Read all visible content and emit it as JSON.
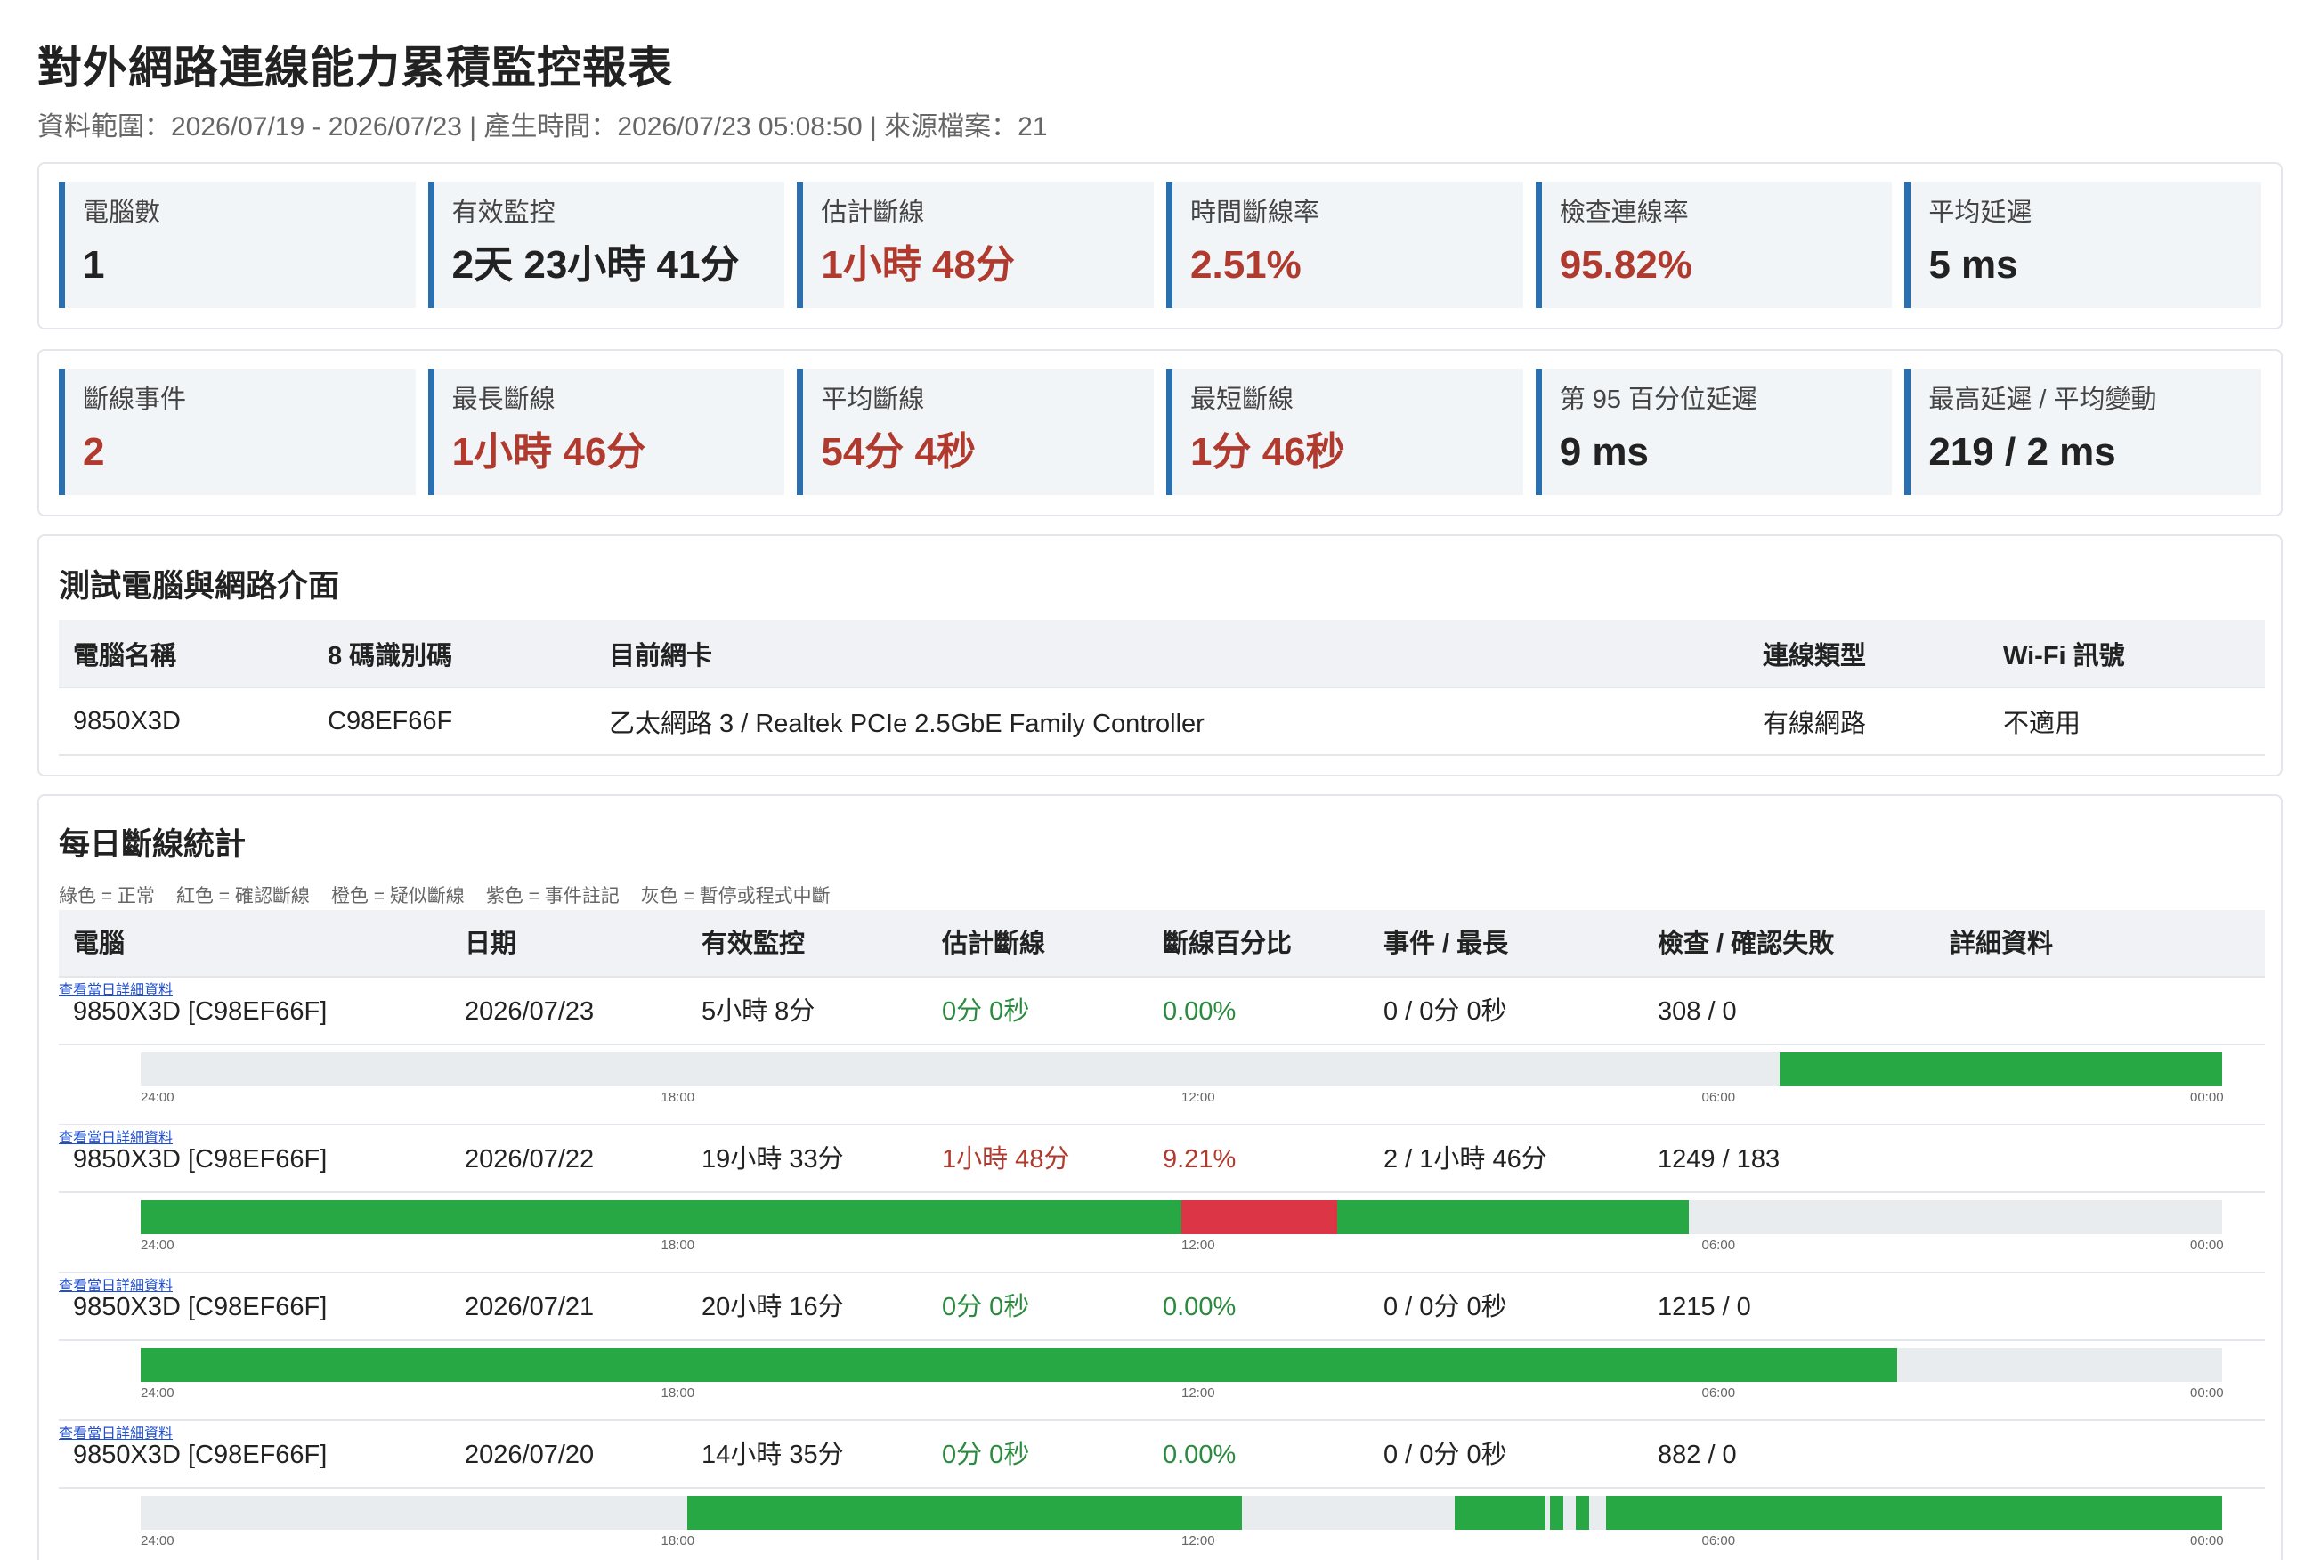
{
  "header": {
    "title": "對外網路連線能力累積監控報表",
    "meta": "資料範圍：2026/07/19 - 2026/07/23 | 產生時間：2026/07/23 05:08:50 | 來源檔案：21"
  },
  "kpis_top": [
    {
      "label": "電腦數",
      "value": "1"
    },
    {
      "label": "有效監控",
      "value": "2天 23小時 41分"
    },
    {
      "label": "估計斷線",
      "value": "1小時 48分"
    },
    {
      "label": "時間斷線率",
      "value": "2.51%"
    },
    {
      "label": "檢查連線率",
      "value": "95.82%"
    },
    {
      "label": "平均延遲",
      "value": "5 ms"
    }
  ],
  "kpis_bottom": [
    {
      "label": "斷線事件",
      "value": "2"
    },
    {
      "label": "最長斷線",
      "value": "1小時 46分"
    },
    {
      "label": "平均斷線",
      "value": "54分 4秒"
    },
    {
      "label": "最短斷線",
      "value": "1分 46秒"
    },
    {
      "label": "第 95 百分位延遲",
      "value": "9 ms"
    },
    {
      "label": "最高延遲 / 平均變動",
      "value": "219 / 2 ms"
    }
  ],
  "colors": {
    "ok": "#28a745",
    "fail": "#dc3545",
    "accent": "#2a6fb0",
    "alert_text": "#b03a2e"
  },
  "pc_section": {
    "title": "測試電腦與網路介面",
    "headers": [
      "電腦名稱",
      "8 碼識別碼",
      "目前網卡",
      "連線類型",
      "Wi-Fi 訊號"
    ],
    "row": [
      "9850X3D",
      "C98EF66F",
      "乙太網路 3 / Realtek PCIe 2.5GbE Family Controller",
      "有線網路",
      "不適用"
    ]
  },
  "daily_section": {
    "title": "每日斷線統計",
    "legend": [
      "綠色 = 正常",
      "紅色 = 確認斷線",
      "橙色 = 疑似斷線",
      "紫色 = 事件註記",
      "灰色 = 暫停或程式中斷"
    ],
    "headers": [
      "電腦",
      "日期",
      "有效監控",
      "估計斷線",
      "斷線百分比",
      "事件 / 最長",
      "檢查 / 確認失敗",
      "詳細資料"
    ],
    "ticks": [
      "24:00",
      "18:00",
      "12:00",
      "06:00",
      "00:00"
    ],
    "rows": [
      {
        "pc": "9850X3D [C98EF66F]",
        "date": "2026/07/23",
        "monitor": "5小時 8分",
        "outage": "0分 0秒",
        "pct": "0.00%",
        "events": "0 / 0分 0秒",
        "checks": "308 / 0",
        "link": "查看當日詳細資料",
        "alert": false,
        "timeline_hours": [
          {
            "from": 0.0,
            "to": 5.1,
            "state": "ok"
          }
        ]
      },
      {
        "pc": "9850X3D [C98EF66F]",
        "date": "2026/07/22",
        "monitor": "19小時 33分",
        "outage": "1小時 48分",
        "pct": "9.21%",
        "events": "2 / 1小時 46分",
        "checks": "1249 / 183",
        "link": "查看當日詳細資料",
        "alert": true,
        "timeline_hours": [
          {
            "from": 11.0,
            "to": 12.25,
            "state": "ok"
          },
          {
            "from": 12.25,
            "to": 12.3,
            "state": "fail"
          },
          {
            "from": 12.3,
            "to": 6.15,
            "state": "ok"
          },
          {
            "from": 8.0,
            "to": 8.1,
            "state": "ok"
          },
          {
            "from": 10.2,
            "to": 12.0,
            "state": "fail"
          },
          {
            "from": 12.0,
            "to": 24.0,
            "state": "ok"
          }
        ]
      },
      {
        "pc": "9850X3D [C98EF66F]",
        "date": "2026/07/21",
        "monitor": "20小時 16分",
        "outage": "0分 0秒",
        "pct": "0.00%",
        "events": "0 / 0分 0秒",
        "checks": "1215 / 0",
        "link": "查看當日詳細資料",
        "alert": false,
        "timeline_hours": [
          {
            "from": 3.75,
            "to": 24.0,
            "state": "ok"
          }
        ]
      },
      {
        "pc": "9850X3D [C98EF66F]",
        "date": "2026/07/20",
        "monitor": "14小時 35分",
        "outage": "0分 0秒",
        "pct": "0.00%",
        "events": "0 / 0分 0秒",
        "checks": "882 / 0",
        "link": "查看當日詳細資料",
        "alert": false,
        "timeline_hours": [
          {
            "from": 0.0,
            "to": 7.1,
            "state": "ok"
          },
          {
            "from": 7.3,
            "to": 7.45,
            "state": "ok"
          },
          {
            "from": 7.6,
            "to": 7.75,
            "state": "ok"
          },
          {
            "from": 7.8,
            "to": 8.85,
            "state": "ok"
          },
          {
            "from": 11.3,
            "to": 17.7,
            "state": "ok"
          }
        ]
      }
    ]
  }
}
